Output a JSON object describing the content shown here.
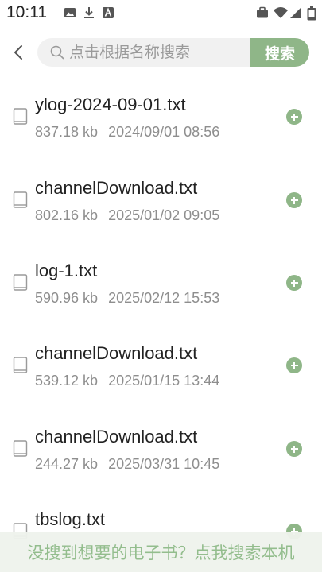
{
  "status_bar": {
    "time": "10:11",
    "left_icons": [
      "image-icon",
      "download-icon",
      "keyboard-a-icon"
    ],
    "right_icons": [
      "briefcase-icon",
      "wifi-icon",
      "signal-icon",
      "battery-icon"
    ]
  },
  "search": {
    "placeholder": "点击根据名称搜索",
    "value": "",
    "button_label": "搜索"
  },
  "files": [
    {
      "name": "ylog-2024-09-01.txt",
      "size": "837.18 kb",
      "date": "2024/09/01 08:56"
    },
    {
      "name": "channelDownload.txt",
      "size": "802.16 kb",
      "date": "2025/01/02 09:05"
    },
    {
      "name": "log-1.txt",
      "size": "590.96 kb",
      "date": "2025/02/12 15:53"
    },
    {
      "name": "channelDownload.txt",
      "size": "539.12 kb",
      "date": "2025/01/15 13:44"
    },
    {
      "name": "channelDownload.txt",
      "size": "244.27 kb",
      "date": "2025/03/31 10:45"
    },
    {
      "name": "tbslog.txt",
      "size": "",
      "date": ""
    }
  ],
  "bottom_banner": "没搜到想要的电子书？点我搜索本机",
  "colors": {
    "accent": "#8fb688",
    "banner_text": "#93bd8d",
    "meta_text": "#8e8e8e"
  }
}
